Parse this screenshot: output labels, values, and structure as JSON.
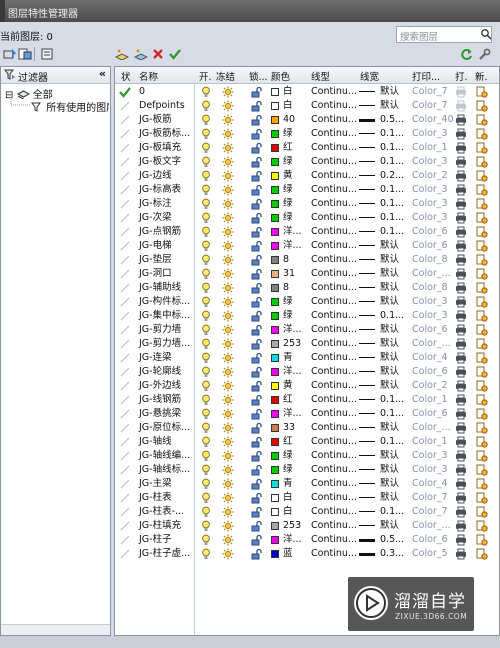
{
  "window": {
    "title": "图层特性管理器"
  },
  "current_layer": {
    "label": "当前图层: 0"
  },
  "search": {
    "placeholder": "搜索图层"
  },
  "filter_panel": {
    "header": "过滤器",
    "collapse_glyph": "«",
    "tree": [
      {
        "label": "全部",
        "expander": "⊟"
      },
      {
        "label": "所有使用的图层"
      }
    ]
  },
  "columns": [
    "状",
    "名称",
    "开.",
    "冻结",
    "锁...",
    "颜色",
    "线型",
    "线宽",
    "打印...",
    "打.",
    "新."
  ],
  "layers": [
    {
      "status": "current",
      "name": "0",
      "color_hex": "#ffffff",
      "color_name": "白",
      "linetype": "Continu...",
      "lineweight": "默认",
      "lw_style": "thin",
      "plot_style": "Color_7",
      "plot": "off"
    },
    {
      "status": "",
      "name": "Defpoints",
      "color_hex": "#ffffff",
      "color_name": "白",
      "linetype": "Continu...",
      "lineweight": "默认",
      "lw_style": "thin",
      "plot_style": "Color_7",
      "plot": "off"
    },
    {
      "status": "",
      "name": "JG-板筋",
      "color_hex": "#ffa500",
      "color_name": "40",
      "linetype": "Continu...",
      "lineweight": "0.5...",
      "lw_style": "thick",
      "plot_style": "Color_40",
      "plot": "on"
    },
    {
      "status": "",
      "name": "JG-板筋标...",
      "color_hex": "#00cc00",
      "color_name": "绿",
      "linetype": "Continu...",
      "lineweight": "0.1...",
      "lw_style": "thin",
      "plot_style": "Color_3",
      "plot": "on"
    },
    {
      "status": "",
      "name": "JG-板填充",
      "color_hex": "#e00000",
      "color_name": "红",
      "linetype": "Continu...",
      "lineweight": "0.1...",
      "lw_style": "thin",
      "plot_style": "Color_1",
      "plot": "on"
    },
    {
      "status": "",
      "name": "JG-板文字",
      "color_hex": "#00cc00",
      "color_name": "绿",
      "linetype": "Continu...",
      "lineweight": "0.1...",
      "lw_style": "thin",
      "plot_style": "Color_3",
      "plot": "on"
    },
    {
      "status": "",
      "name": "JG-边线",
      "color_hex": "#ffff00",
      "color_name": "黄",
      "linetype": "Continu...",
      "lineweight": "0.2...",
      "lw_style": "thin",
      "plot_style": "Color_2",
      "plot": "on"
    },
    {
      "status": "",
      "name": "JG-标高表",
      "color_hex": "#00cc00",
      "color_name": "绿",
      "linetype": "Continu...",
      "lineweight": "0.1...",
      "lw_style": "thin",
      "plot_style": "Color_3",
      "plot": "on"
    },
    {
      "status": "",
      "name": "JG-标注",
      "color_hex": "#00cc00",
      "color_name": "绿",
      "linetype": "Continu...",
      "lineweight": "0.1...",
      "lw_style": "thin",
      "plot_style": "Color_3",
      "plot": "on"
    },
    {
      "status": "",
      "name": "JG-次梁",
      "color_hex": "#00cc00",
      "color_name": "绿",
      "linetype": "Continu...",
      "lineweight": "0.1...",
      "lw_style": "thin",
      "plot_style": "Color_3",
      "plot": "on"
    },
    {
      "status": "",
      "name": "JG-点钢筋",
      "color_hex": "#ff00ff",
      "color_name": "洋...",
      "linetype": "Continu...",
      "lineweight": "0.1...",
      "lw_style": "thin",
      "plot_style": "Color_6",
      "plot": "on"
    },
    {
      "status": "",
      "name": "JG-电梯",
      "color_hex": "#ff00ff",
      "color_name": "洋...",
      "linetype": "Continu...",
      "lineweight": "默认",
      "lw_style": "thin",
      "plot_style": "Color_6",
      "plot": "on"
    },
    {
      "status": "",
      "name": "JG-垫层",
      "color_hex": "#808080",
      "color_name": "8",
      "linetype": "Continu...",
      "lineweight": "默认",
      "lw_style": "thin",
      "plot_style": "Color_8",
      "plot": "on"
    },
    {
      "status": "",
      "name": "JG-洞口",
      "color_hex": "#f0b080",
      "color_name": "31",
      "linetype": "Continu...",
      "lineweight": "默认",
      "lw_style": "thin",
      "plot_style": "Color_...",
      "plot": "on"
    },
    {
      "status": "",
      "name": "JG-辅助线",
      "color_hex": "#808080",
      "color_name": "8",
      "linetype": "Continu...",
      "lineweight": "默认",
      "lw_style": "thin",
      "plot_style": "Color_8",
      "plot": "on"
    },
    {
      "status": "",
      "name": "JG-构件标...",
      "color_hex": "#00cc00",
      "color_name": "绿",
      "linetype": "Continu...",
      "lineweight": "默认",
      "lw_style": "thin",
      "plot_style": "Color_3",
      "plot": "on"
    },
    {
      "status": "",
      "name": "JG-集中标...",
      "color_hex": "#00cc00",
      "color_name": "绿",
      "linetype": "Continu...",
      "lineweight": "0.1...",
      "lw_style": "thin",
      "plot_style": "Color_3",
      "plot": "on"
    },
    {
      "status": "",
      "name": "JG-剪力墙",
      "color_hex": "#ff00ff",
      "color_name": "洋...",
      "linetype": "Continu...",
      "lineweight": "默认",
      "lw_style": "thin",
      "plot_style": "Color_6",
      "plot": "on"
    },
    {
      "status": "",
      "name": "JG-剪力墙...",
      "color_hex": "#a8a8a8",
      "color_name": "253",
      "linetype": "Continu...",
      "lineweight": "默认",
      "lw_style": "thin",
      "plot_style": "Color_...",
      "plot": "on"
    },
    {
      "status": "",
      "name": "JG-连梁",
      "color_hex": "#00e0e0",
      "color_name": "青",
      "linetype": "Continu...",
      "lineweight": "默认",
      "lw_style": "thin",
      "plot_style": "Color_4",
      "plot": "on"
    },
    {
      "status": "",
      "name": "JG-轮廓线",
      "color_hex": "#ff00ff",
      "color_name": "洋...",
      "linetype": "Continu...",
      "lineweight": "默认",
      "lw_style": "thin",
      "plot_style": "Color_6",
      "plot": "on"
    },
    {
      "status": "",
      "name": "JG-外边线",
      "color_hex": "#ffff00",
      "color_name": "黄",
      "linetype": "Continu...",
      "lineweight": "默认",
      "lw_style": "thin",
      "plot_style": "Color_2",
      "plot": "on"
    },
    {
      "status": "",
      "name": "JG-线钢筋",
      "color_hex": "#e00000",
      "color_name": "红",
      "linetype": "Continu...",
      "lineweight": "0.1...",
      "lw_style": "thin",
      "plot_style": "Color_1",
      "plot": "on"
    },
    {
      "status": "",
      "name": "JG-悬挑梁",
      "color_hex": "#ff00ff",
      "color_name": "洋...",
      "linetype": "Continu...",
      "lineweight": "0.1...",
      "lw_style": "thin",
      "plot_style": "Color_6",
      "plot": "on"
    },
    {
      "status": "",
      "name": "JG-原位标...",
      "color_hex": "#d07850",
      "color_name": "33",
      "linetype": "Continu...",
      "lineweight": "默认",
      "lw_style": "thin",
      "plot_style": "Color_...",
      "plot": "on"
    },
    {
      "status": "",
      "name": "JG-轴线",
      "color_hex": "#e00000",
      "color_name": "红",
      "linetype": "Continu...",
      "lineweight": "0.1...",
      "lw_style": "thin",
      "plot_style": "Color_1",
      "plot": "on"
    },
    {
      "status": "",
      "name": "JG-轴线编...",
      "color_hex": "#00cc00",
      "color_name": "绿",
      "linetype": "Continu...",
      "lineweight": "默认",
      "lw_style": "thin",
      "plot_style": "Color_3",
      "plot": "on"
    },
    {
      "status": "",
      "name": "JG-轴线标...",
      "color_hex": "#00cc00",
      "color_name": "绿",
      "linetype": "Continu...",
      "lineweight": "默认",
      "lw_style": "thin",
      "plot_style": "Color_3",
      "plot": "on"
    },
    {
      "status": "",
      "name": "JG-主梁",
      "color_hex": "#00e0e0",
      "color_name": "青",
      "linetype": "Continu...",
      "lineweight": "默认",
      "lw_style": "thin",
      "plot_style": "Color_4",
      "plot": "on"
    },
    {
      "status": "",
      "name": "JG-柱表",
      "color_hex": "#ffffff",
      "color_name": "白",
      "linetype": "Continu...",
      "lineweight": "默认",
      "lw_style": "thin",
      "plot_style": "Color_7",
      "plot": "on"
    },
    {
      "status": "",
      "name": "JG-柱表-...",
      "color_hex": "#ffffff",
      "color_name": "白",
      "linetype": "Continu...",
      "lineweight": "0.1...",
      "lw_style": "thin",
      "plot_style": "Color_7",
      "plot": "on"
    },
    {
      "status": "",
      "name": "JG-柱填充",
      "color_hex": "#a8a8a8",
      "color_name": "253",
      "linetype": "Continu...",
      "lineweight": "默认",
      "lw_style": "thin",
      "plot_style": "Color_...",
      "plot": "on"
    },
    {
      "status": "",
      "name": "JG-柱子",
      "color_hex": "#ff00ff",
      "color_name": "洋...",
      "linetype": "Continu...",
      "lineweight": "0.5...",
      "lw_style": "thick",
      "plot_style": "Color_6",
      "plot": "on"
    },
    {
      "status": "",
      "name": "JG-柱子虚...",
      "color_hex": "#0000cc",
      "color_name": "蓝",
      "linetype": "Continu...",
      "lineweight": "0.3...",
      "lw_style": "thick",
      "plot_style": "Color_5",
      "plot": "on"
    }
  ],
  "watermark": {
    "title": "溜溜自学",
    "subtitle": "ZIXUE.3D66.COM"
  }
}
